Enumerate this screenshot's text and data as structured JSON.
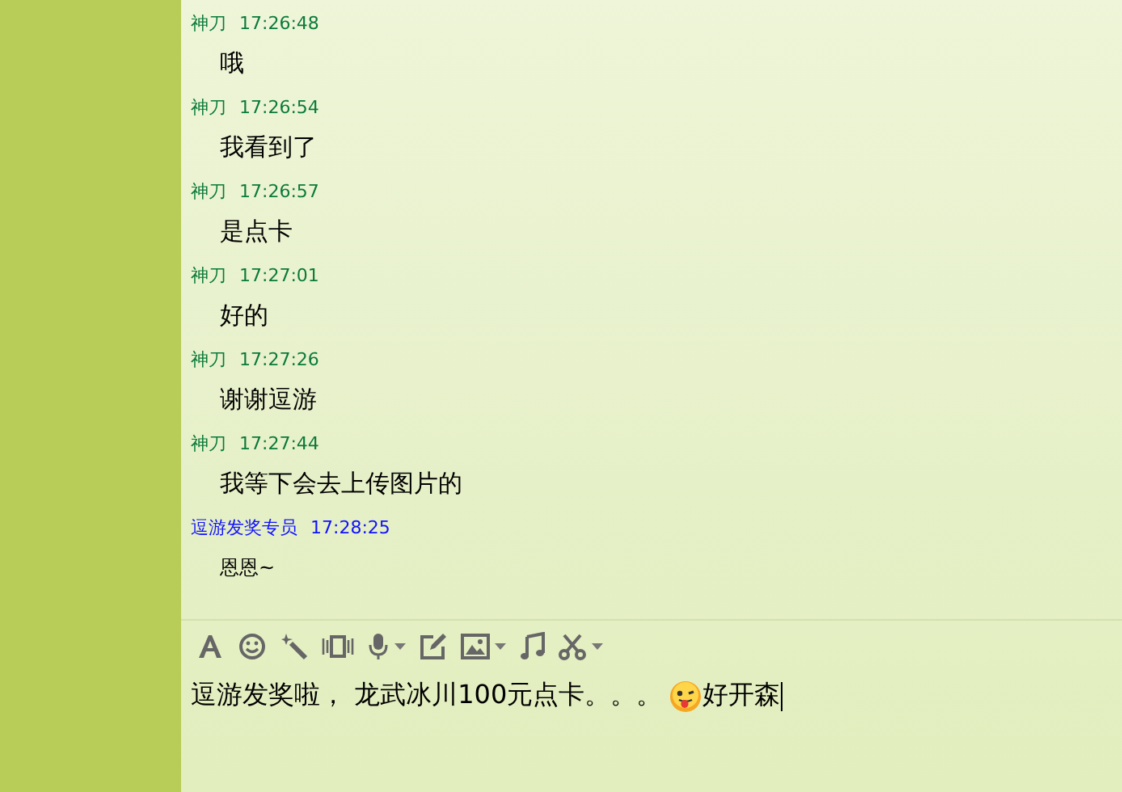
{
  "messages": [
    {
      "sender": "神刀",
      "time": "17:26:48",
      "text": "哦",
      "color": "#0a7a3a",
      "kind": "normal"
    },
    {
      "sender": "神刀",
      "time": "17:26:54",
      "text": "我看到了",
      "color": "#0a7a3a",
      "kind": "normal"
    },
    {
      "sender": "神刀",
      "time": "17:26:57",
      "text": "是点卡",
      "color": "#0a7a3a",
      "kind": "normal"
    },
    {
      "sender": "神刀",
      "time": "17:27:01",
      "text": "好的",
      "color": "#0a7a3a",
      "kind": "normal"
    },
    {
      "sender": "神刀",
      "time": "17:27:26",
      "text": "谢谢逗游",
      "color": "#0a7a3a",
      "kind": "normal"
    },
    {
      "sender": "神刀",
      "time": "17:27:44",
      "text": "我等下会去上传图片的",
      "color": "#0a7a3a",
      "kind": "normal"
    },
    {
      "sender": "逗游发奖专员",
      "time": "17:28:25",
      "text": "恩恩~",
      "color": "#1010ff",
      "kind": "small"
    }
  ],
  "composer": {
    "text_before_emoji": "逗游发奖啦， 龙武冰川100元点卡。。。",
    "text_after_emoji": "好开森"
  }
}
